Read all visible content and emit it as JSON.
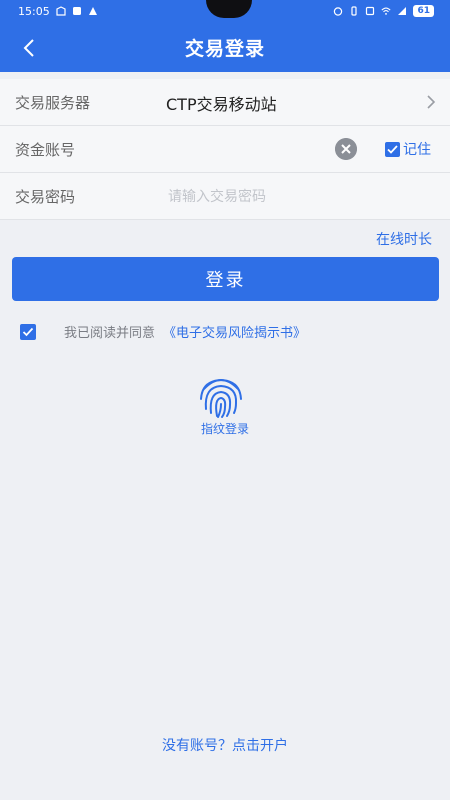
{
  "status_bar": {
    "time": "15:05",
    "battery": "61"
  },
  "header": {
    "title": "交易登录"
  },
  "form": {
    "server_label": "交易服务器",
    "server_value": "CTP交易移动站",
    "account_label": "资金账号",
    "account_value": "",
    "remember_label": "记住",
    "remember_checked": true,
    "password_label": "交易密码",
    "password_placeholder": "请输入交易密码"
  },
  "online_duration": "在线时长",
  "login_button": "登录",
  "agreement": {
    "checked": true,
    "text": "我已阅读并同意",
    "link": "《电子交易风险揭示书》"
  },
  "fingerprint_label": "指纹登录",
  "register_link": "没有账号？点击开户",
  "colors": {
    "accent": "#2f6fe6",
    "background": "#eef0f4"
  }
}
